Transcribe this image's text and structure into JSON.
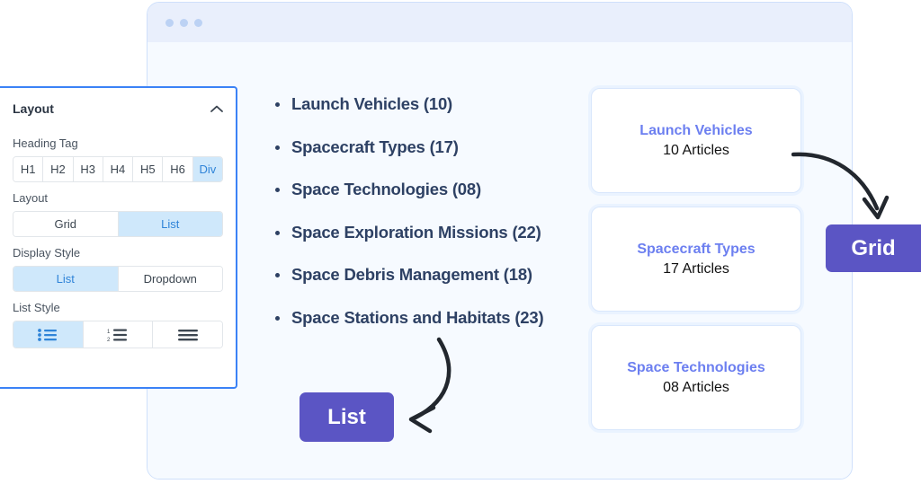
{
  "window": {
    "dots_count": 3,
    "dot_icon": "window-control-dot"
  },
  "list_preview": {
    "items": [
      "Launch Vehicles (10)",
      "Spacecraft Types (17)",
      "Space Technologies (08)",
      "Space Exploration Missions (22)",
      "Space Debris Management (18)",
      "Space Stations and Habitats (23)"
    ]
  },
  "grid_preview": {
    "cards": [
      {
        "title": "Launch Vehicles",
        "count": "10 Articles"
      },
      {
        "title": "Spacecraft Types",
        "count": "17 Articles"
      },
      {
        "title": "Space Technologies",
        "count": "08 Articles"
      }
    ]
  },
  "badges": {
    "grid": "Grid",
    "list": "List"
  },
  "settings_panel": {
    "title": "Layout",
    "collapse_icon": "chevron-up-icon",
    "heading_tag": {
      "label": "Heading Tag",
      "options": [
        "H1",
        "H2",
        "H3",
        "H4",
        "H5",
        "H6",
        "Div"
      ],
      "selected": "Div"
    },
    "layout": {
      "label": "Layout",
      "options": [
        "Grid",
        "List"
      ],
      "selected": "List"
    },
    "display_style": {
      "label": "Display Style",
      "options": [
        "List",
        "Dropdown"
      ],
      "selected": "List"
    },
    "list_style": {
      "label": "List Style",
      "options": [
        "bulleted-list-icon",
        "numbered-list-icon",
        "plain-list-icon"
      ],
      "selected": "bulleted-list-icon"
    }
  },
  "colors": {
    "accent_blue": "#3b82f6",
    "active_seg": "#cfe8fb",
    "badge_purple": "#5b55c4",
    "card_title": "#6c7ff0",
    "list_text": "#2e4164"
  }
}
